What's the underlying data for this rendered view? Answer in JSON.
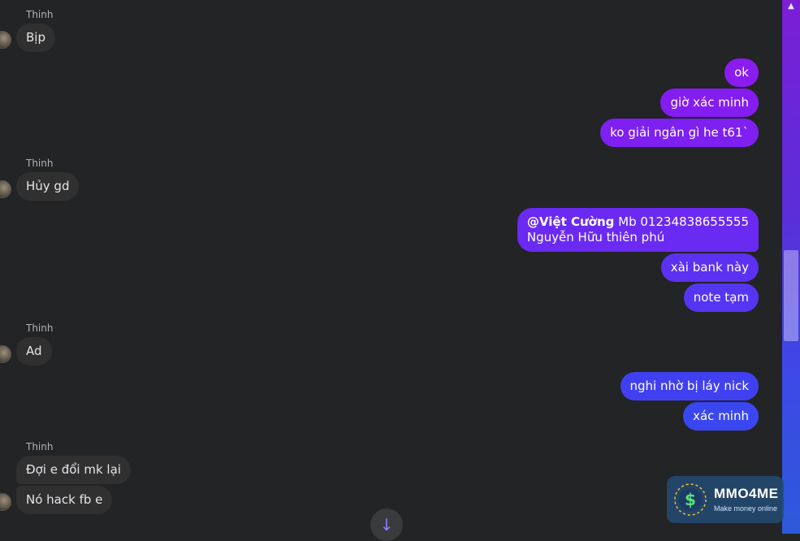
{
  "conversation": {
    "sender_name": "Thinh",
    "incoming_1": "Bịp",
    "incoming_2": "Hủy gd",
    "incoming_3": "Ad",
    "incoming_4": "Đợi e đổi mk lại",
    "incoming_5": "Nó hack fb e",
    "outgoing_1": "ok",
    "outgoing_2": "giờ xác minh",
    "outgoing_3": "ko giải ngân gì he t61`",
    "outgoing_4_mention": "@Việt Cường",
    "outgoing_4_line1_rest": " Mb 01234838655555",
    "outgoing_4_line2": "Nguyễn Hữu thiên phú",
    "outgoing_5": "xài bank này",
    "outgoing_6": "note tạm",
    "outgoing_7": "nghi nhờ bị láy nick",
    "outgoing_8": "xác minh"
  },
  "controls": {
    "jump_to_latest_icon": "arrow-down-icon"
  },
  "watermark": {
    "name": "MMO4ME",
    "tagline": "Make money online"
  },
  "colors": {
    "background": "#232426",
    "incoming_bubble": "#303030",
    "outgoing_top": "#8a1cf0",
    "outgoing_bottom": "#3a47f0"
  }
}
